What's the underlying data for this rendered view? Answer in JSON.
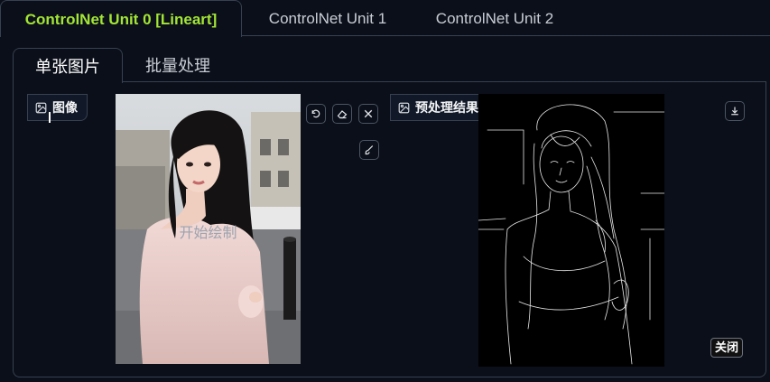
{
  "unit_tabs": [
    {
      "label": "ControlNet Unit 0 [Lineart]",
      "active": true
    },
    {
      "label": "ControlNet Unit 1",
      "active": false
    },
    {
      "label": "ControlNet Unit 2",
      "active": false
    }
  ],
  "sub_tabs": [
    {
      "label": "单张图片",
      "active": true
    },
    {
      "label": "批量处理",
      "active": false
    }
  ],
  "input_image": {
    "label": "图像",
    "overlay_text": "开始绘制"
  },
  "preview_image": {
    "label": "预处理结果预览",
    "close_label": "关闭"
  },
  "icons": {
    "undo": "undo-icon",
    "eraser": "eraser-icon",
    "clear": "close-icon",
    "brush": "brush-icon",
    "download": "download-icon",
    "image": "image-icon"
  },
  "colors": {
    "active_unit_tab": "#a3e635",
    "background": "#0b0f19",
    "border": "#374151"
  }
}
